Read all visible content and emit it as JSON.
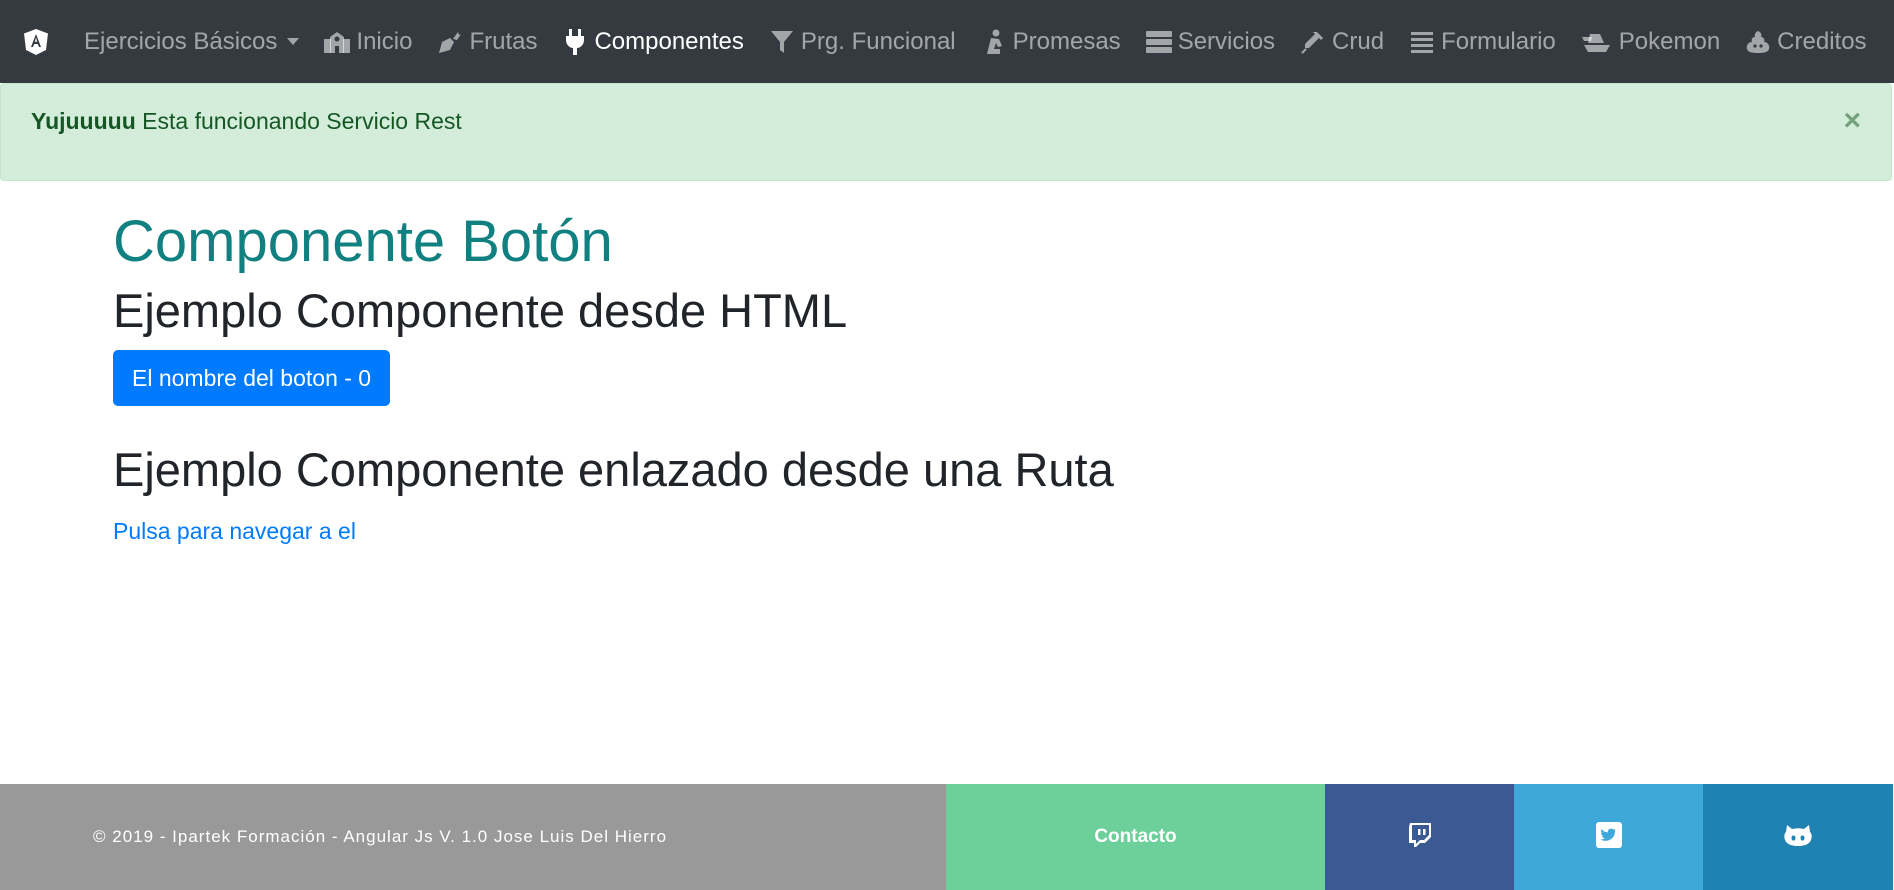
{
  "navbar": {
    "items": [
      {
        "label": "Ejercicios Básicos",
        "icon": "caret-down-icon"
      },
      {
        "label": "Inicio",
        "icon": "school-icon"
      },
      {
        "label": "Frutas",
        "icon": "carrot-icon"
      },
      {
        "label": "Componentes",
        "icon": "plug-icon"
      },
      {
        "label": "Prg. Funcional",
        "icon": "filter-icon"
      },
      {
        "label": "Promesas",
        "icon": "praying-icon"
      },
      {
        "label": "Servicios",
        "icon": "server-icon"
      },
      {
        "label": "Crud",
        "icon": "syringe-icon"
      },
      {
        "label": "Formulario",
        "icon": "list-icon"
      },
      {
        "label": "Pokemon",
        "icon": "ship-icon"
      },
      {
        "label": "Creditos",
        "icon": "poo-icon"
      }
    ],
    "active_item": "Componentes"
  },
  "alert": {
    "strong": "Yujuuuuu",
    "message": " Esta funcionando Servicio Rest",
    "close": "×"
  },
  "main": {
    "title": "Componente Botón",
    "subtitle1": "Ejemplo Componente desde HTML",
    "button_label": "El nombre del boton - 0",
    "subtitle2": "Ejemplo Componente enlazado desde una Ruta",
    "link_label": "Pulsa para navegar a el"
  },
  "footer": {
    "copyright": "© 2019 - Ipartek Formación - Angular Js V. 1.0 Jose Luis Del Hierro",
    "contact_label": "Contacto",
    "social": [
      "twitch-icon",
      "twitter-icon",
      "github-icon"
    ]
  },
  "colors": {
    "navbar_bg": "#343a40",
    "alert_bg": "#d4edda",
    "title_teal": "#108080",
    "primary": "#007bff",
    "footer_grey": "#999999",
    "contact_green": "#6dcf9a",
    "twitch_blue": "#3b5a93",
    "twitter_blue": "#3ea8da",
    "github_blue": "#1f82b0"
  }
}
